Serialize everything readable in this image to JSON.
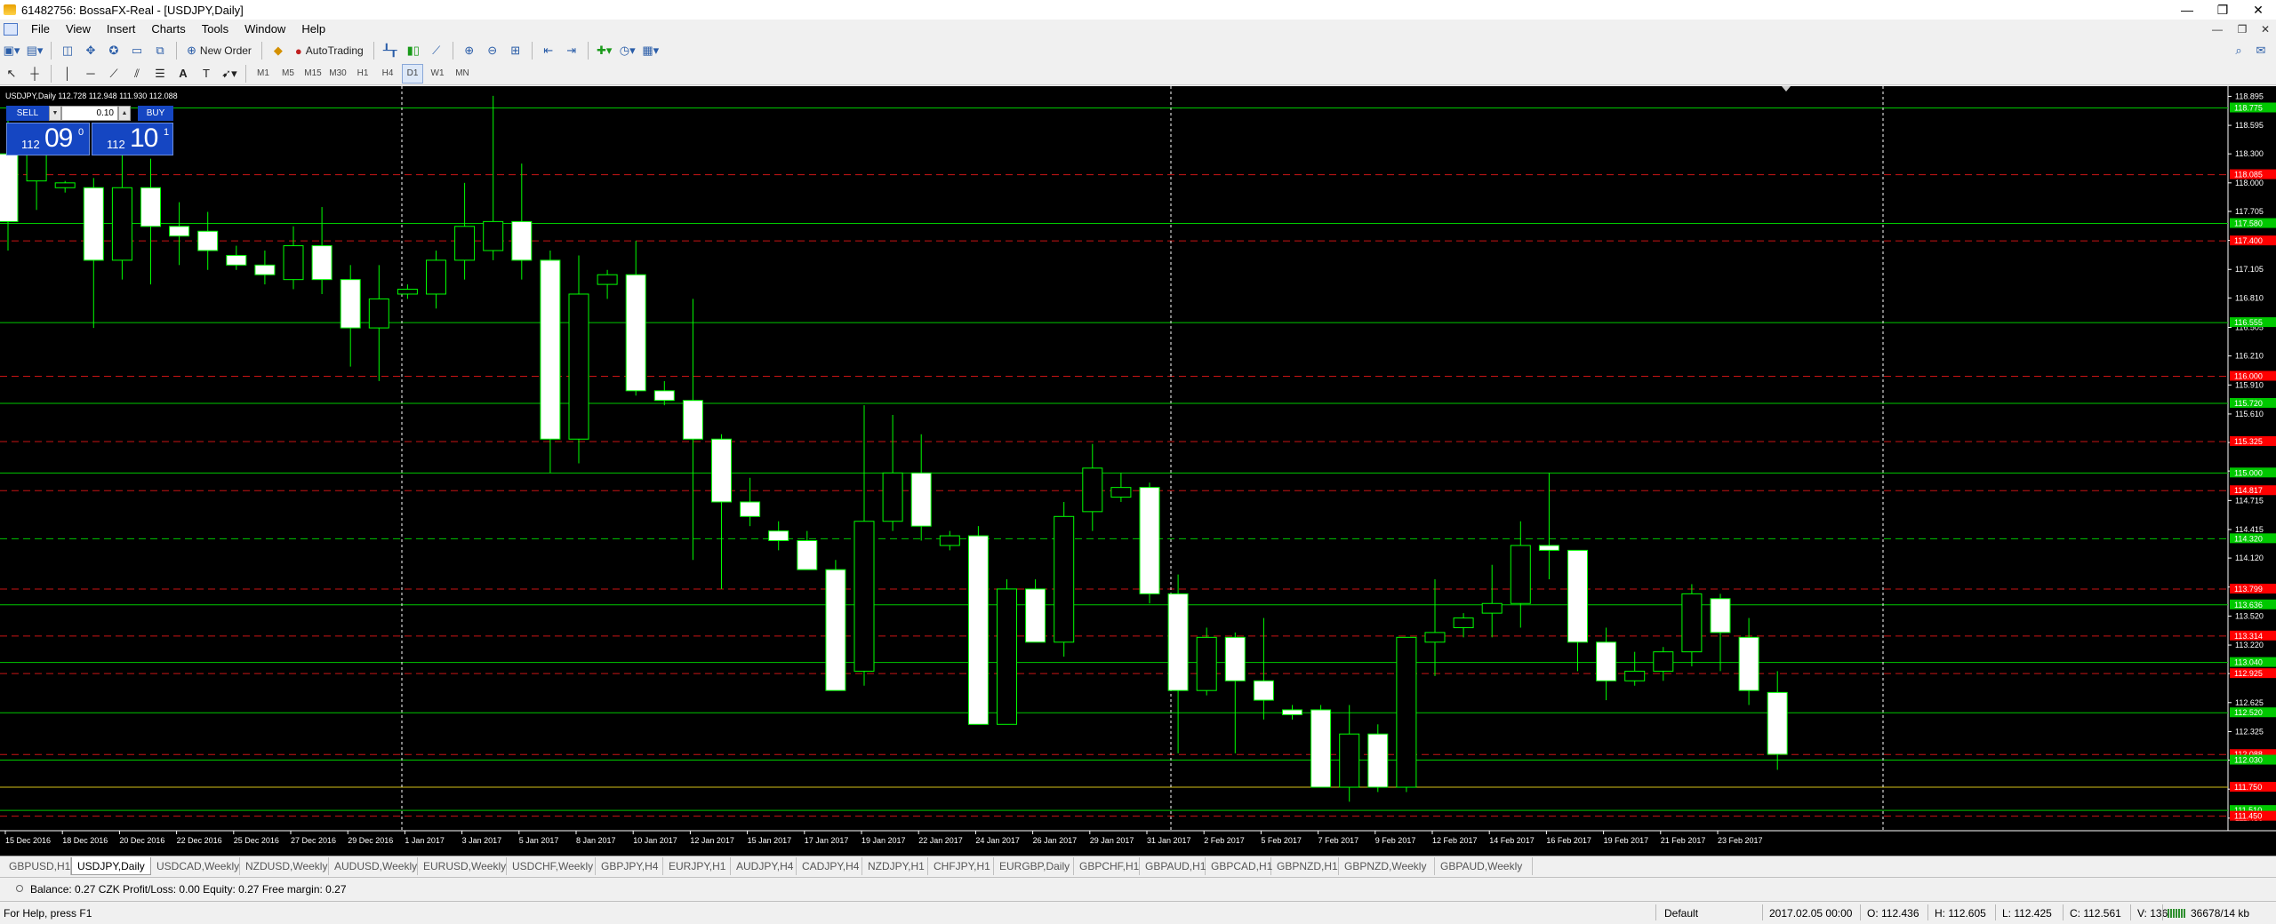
{
  "window": {
    "title": "61482756: BossaFX-Real - [USDJPY,Daily]",
    "controls": [
      "—",
      "❐",
      "✕"
    ],
    "mdi_controls": [
      "—",
      "❐",
      "✕"
    ]
  },
  "menu": [
    "File",
    "View",
    "Insert",
    "Charts",
    "Tools",
    "Window",
    "Help"
  ],
  "toolbar1": {
    "new_order": "New Order",
    "auto_trading": "AutoTrading"
  },
  "timeframes": [
    "M1",
    "M5",
    "M15",
    "M30",
    "H1",
    "H4",
    "D1",
    "W1",
    "MN"
  ],
  "chart": {
    "info": "USDJPY,Daily  112.728 112.948 111.930 112.088",
    "sell_label": "SELL",
    "buy_label": "BUY",
    "lot": "0.10",
    "bid": {
      "small": "112",
      "big": "09",
      "sup": "0"
    },
    "ask": {
      "small": "112",
      "big": "10",
      "sup": "1"
    },
    "colors": {
      "background": "#000000",
      "candle_up": "#000000",
      "candle_down": "#ffffff",
      "candle_border": "#00ff00",
      "hline_green": "#00c800",
      "hline_red": "#c81414",
      "price_tag_green": "#00c800",
      "price_tag_red": "#ff0000",
      "ask_line": "#d4c018"
    },
    "ticks": [
      "118.895",
      "118.595",
      "118.300",
      "118.000",
      "117.705",
      "117.405",
      "117.105",
      "116.810",
      "116.505",
      "116.210",
      "115.910",
      "115.610",
      "115.315",
      "115.020",
      "114.715",
      "114.415",
      "114.120",
      "113.820",
      "113.520",
      "113.220",
      "112.925",
      "112.625",
      "112.325",
      "112.030",
      "111.730",
      "111.430"
    ],
    "price_tags": [
      {
        "price": "118.775",
        "color": "green"
      },
      {
        "price": "118.085",
        "color": "red"
      },
      {
        "price": "117.580",
        "color": "green"
      },
      {
        "price": "117.400",
        "color": "red"
      },
      {
        "price": "116.555",
        "color": "green"
      },
      {
        "price": "116.000",
        "color": "red"
      },
      {
        "price": "115.720",
        "color": "green"
      },
      {
        "price": "115.325",
        "color": "red"
      },
      {
        "price": "115.000",
        "color": "green"
      },
      {
        "price": "114.817",
        "color": "red"
      },
      {
        "price": "114.320",
        "color": "green"
      },
      {
        "price": "113.799",
        "color": "red"
      },
      {
        "price": "113.636",
        "color": "green"
      },
      {
        "price": "113.314",
        "color": "red"
      },
      {
        "price": "113.040",
        "color": "green"
      },
      {
        "price": "112.925",
        "color": "red"
      },
      {
        "price": "112.520",
        "color": "green"
      },
      {
        "price": "112.088",
        "color": "red"
      },
      {
        "price": "112.030",
        "color": "green"
      },
      {
        "price": "111.750",
        "color": "red"
      },
      {
        "price": "111.510",
        "color": "green"
      },
      {
        "price": "111.450",
        "color": "red"
      }
    ],
    "dates": [
      "15 Dec 2016",
      "18 Dec 2016",
      "20 Dec 2016",
      "22 Dec 2016",
      "25 Dec 2016",
      "27 Dec 2016",
      "29 Dec 2016",
      "1 Jan 2017",
      "3 Jan 2017",
      "5 Jan 2017",
      "8 Jan 2017",
      "10 Jan 2017",
      "12 Jan 2017",
      "15 Jan 2017",
      "17 Jan 2017",
      "19 Jan 2017",
      "22 Jan 2017",
      "24 Jan 2017",
      "26 Jan 2017",
      "29 Jan 2017",
      "31 Jan 2017",
      "2 Feb 2017",
      "5 Feb 2017",
      "7 Feb 2017",
      "9 Feb 2017",
      "12 Feb 2017",
      "14 Feb 2017",
      "16 Feb 2017",
      "19 Feb 2017",
      "21 Feb 2017",
      "23 Feb 2017"
    ]
  },
  "chart_data": {
    "type": "candlestick",
    "symbol": "USDJPY",
    "timeframe": "Daily",
    "ylim": [
      111.3,
      119.0
    ],
    "candles": [
      {
        "o": 118.3,
        "h": 118.7,
        "l": 117.3,
        "c": 117.6
      },
      {
        "o": 118.02,
        "h": 118.52,
        "l": 117.72,
        "c": 118.3
      },
      {
        "o": 117.95,
        "h": 118.02,
        "l": 117.9,
        "c": 118.0
      },
      {
        "o": 117.95,
        "h": 118.05,
        "l": 116.5,
        "c": 117.2
      },
      {
        "o": 117.2,
        "h": 118.3,
        "l": 117.0,
        "c": 117.95
      },
      {
        "o": 117.95,
        "h": 118.25,
        "l": 116.95,
        "c": 117.55
      },
      {
        "o": 117.55,
        "h": 117.8,
        "l": 117.15,
        "c": 117.45
      },
      {
        "o": 117.5,
        "h": 117.7,
        "l": 117.1,
        "c": 117.3
      },
      {
        "o": 117.25,
        "h": 117.35,
        "l": 117.1,
        "c": 117.15
      },
      {
        "o": 117.15,
        "h": 117.3,
        "l": 116.95,
        "c": 117.05
      },
      {
        "o": 117.0,
        "h": 117.55,
        "l": 116.9,
        "c": 117.35
      },
      {
        "o": 117.35,
        "h": 117.75,
        "l": 116.85,
        "c": 117.0
      },
      {
        "o": 117.0,
        "h": 117.15,
        "l": 116.1,
        "c": 116.5
      },
      {
        "o": 116.5,
        "h": 117.15,
        "l": 115.95,
        "c": 116.8
      },
      {
        "o": 116.85,
        "h": 116.95,
        "l": 116.8,
        "c": 116.9
      },
      {
        "o": 116.85,
        "h": 117.3,
        "l": 116.7,
        "c": 117.2
      },
      {
        "o": 117.2,
        "h": 118.0,
        "l": 117.0,
        "c": 117.55
      },
      {
        "o": 117.3,
        "h": 118.9,
        "l": 117.2,
        "c": 117.6
      },
      {
        "o": 117.6,
        "h": 118.2,
        "l": 117.0,
        "c": 117.2
      },
      {
        "o": 117.2,
        "h": 117.3,
        "l": 115.0,
        "c": 115.35
      },
      {
        "o": 115.35,
        "h": 117.25,
        "l": 115.1,
        "c": 116.85
      },
      {
        "o": 116.95,
        "h": 117.1,
        "l": 116.8,
        "c": 117.05
      },
      {
        "o": 117.05,
        "h": 117.4,
        "l": 115.8,
        "c": 115.85
      },
      {
        "o": 115.85,
        "h": 115.95,
        "l": 115.7,
        "c": 115.75
      },
      {
        "o": 115.75,
        "h": 116.8,
        "l": 114.1,
        "c": 115.35
      },
      {
        "o": 115.35,
        "h": 115.4,
        "l": 113.8,
        "c": 114.7
      },
      {
        "o": 114.7,
        "h": 114.95,
        "l": 114.45,
        "c": 114.55
      },
      {
        "o": 114.4,
        "h": 114.5,
        "l": 114.2,
        "c": 114.3
      },
      {
        "o": 114.3,
        "h": 114.4,
        "l": 114.05,
        "c": 114.0
      },
      {
        "o": 114.0,
        "h": 114.1,
        "l": 112.8,
        "c": 112.75
      },
      {
        "o": 112.95,
        "h": 115.7,
        "l": 112.8,
        "c": 114.5
      },
      {
        "o": 114.5,
        "h": 115.6,
        "l": 114.4,
        "c": 115.0
      },
      {
        "o": 115.0,
        "h": 115.4,
        "l": 114.3,
        "c": 114.45
      },
      {
        "o": 114.25,
        "h": 114.4,
        "l": 114.2,
        "c": 114.35
      },
      {
        "o": 114.35,
        "h": 114.45,
        "l": 112.4,
        "c": 112.4
      },
      {
        "o": 112.4,
        "h": 113.9,
        "l": 112.4,
        "c": 113.8
      },
      {
        "o": 113.8,
        "h": 113.9,
        "l": 113.3,
        "c": 113.25
      },
      {
        "o": 113.25,
        "h": 114.7,
        "l": 113.1,
        "c": 114.55
      },
      {
        "o": 114.6,
        "h": 115.3,
        "l": 114.4,
        "c": 115.05
      },
      {
        "o": 114.75,
        "h": 115.0,
        "l": 114.7,
        "c": 114.85
      },
      {
        "o": 114.85,
        "h": 114.9,
        "l": 113.65,
        "c": 113.75
      },
      {
        "o": 113.75,
        "h": 113.95,
        "l": 112.1,
        "c": 112.75
      },
      {
        "o": 112.75,
        "h": 113.4,
        "l": 112.7,
        "c": 113.3
      },
      {
        "o": 113.3,
        "h": 113.35,
        "l": 112.1,
        "c": 112.85
      },
      {
        "o": 112.85,
        "h": 113.5,
        "l": 112.45,
        "c": 112.65
      },
      {
        "o": 112.55,
        "h": 112.6,
        "l": 112.45,
        "c": 112.5
      },
      {
        "o": 112.55,
        "h": 112.6,
        "l": 111.8,
        "c": 111.75
      },
      {
        "o": 111.75,
        "h": 112.6,
        "l": 111.6,
        "c": 112.3
      },
      {
        "o": 112.3,
        "h": 112.4,
        "l": 111.7,
        "c": 111.75
      },
      {
        "o": 111.75,
        "h": 113.3,
        "l": 111.7,
        "c": 113.3
      },
      {
        "o": 113.25,
        "h": 113.9,
        "l": 112.9,
        "c": 113.35
      },
      {
        "o": 113.4,
        "h": 113.55,
        "l": 113.3,
        "c": 113.5
      },
      {
        "o": 113.55,
        "h": 114.05,
        "l": 113.3,
        "c": 113.65
      },
      {
        "o": 113.65,
        "h": 114.5,
        "l": 113.4,
        "c": 114.25
      },
      {
        "o": 114.25,
        "h": 115.0,
        "l": 113.9,
        "c": 114.2
      },
      {
        "o": 114.2,
        "h": 114.2,
        "l": 112.95,
        "c": 113.25
      },
      {
        "o": 113.25,
        "h": 113.4,
        "l": 112.65,
        "c": 112.85
      },
      {
        "o": 112.85,
        "h": 113.15,
        "l": 112.8,
        "c": 112.95
      },
      {
        "o": 112.95,
        "h": 113.2,
        "l": 112.85,
        "c": 113.15
      },
      {
        "o": 113.15,
        "h": 113.85,
        "l": 113.0,
        "c": 113.75
      },
      {
        "o": 113.7,
        "h": 113.75,
        "l": 112.95,
        "c": 113.35
      },
      {
        "o": 113.3,
        "h": 113.5,
        "l": 112.6,
        "c": 112.75
      },
      {
        "o": 112.73,
        "h": 112.95,
        "l": 111.93,
        "c": 112.09
      }
    ],
    "horizontal_lines": [
      {
        "price": 118.775,
        "color": "green",
        "style": "solid"
      },
      {
        "price": 118.085,
        "color": "red",
        "style": "dashed"
      },
      {
        "price": 117.58,
        "color": "green",
        "style": "solid"
      },
      {
        "price": 117.4,
        "color": "red",
        "style": "dashed"
      },
      {
        "price": 116.555,
        "color": "green",
        "style": "solid"
      },
      {
        "price": 116.0,
        "color": "red",
        "style": "dashed"
      },
      {
        "price": 115.72,
        "color": "green",
        "style": "solid"
      },
      {
        "price": 115.325,
        "color": "red",
        "style": "dashed"
      },
      {
        "price": 115.0,
        "color": "green",
        "style": "solid"
      },
      {
        "price": 114.817,
        "color": "red",
        "style": "dashed"
      },
      {
        "price": 114.32,
        "color": "green",
        "style": "dashed"
      },
      {
        "price": 113.799,
        "color": "red",
        "style": "dashed"
      },
      {
        "price": 113.636,
        "color": "green",
        "style": "solid"
      },
      {
        "price": 113.314,
        "color": "red",
        "style": "dashed"
      },
      {
        "price": 113.04,
        "color": "green",
        "style": "solid"
      },
      {
        "price": 112.925,
        "color": "red",
        "style": "dashed"
      },
      {
        "price": 112.52,
        "color": "green",
        "style": "solid"
      },
      {
        "price": 112.088,
        "color": "red",
        "style": "dashed"
      },
      {
        "price": 112.03,
        "color": "green",
        "style": "solid"
      },
      {
        "price": 111.75,
        "color": "gold",
        "style": "solid"
      },
      {
        "price": 111.51,
        "color": "green",
        "style": "solid"
      },
      {
        "price": 111.45,
        "color": "red",
        "style": "dashed"
      }
    ],
    "vertical_separators": [
      "1 Jan 2017",
      "1 Feb 2017",
      "1 Mar 2017"
    ],
    "grid": false
  },
  "tabs": {
    "items": [
      "GBPUSD,H1",
      "USDJPY,Daily",
      "USDCAD,Weekly",
      "NZDUSD,Weekly",
      "AUDUSD,Weekly",
      "EURUSD,Weekly",
      "USDCHF,Weekly",
      "GBPJPY,H4",
      "EURJPY,H1",
      "AUDJPY,H4",
      "CADJPY,H4",
      "NZDJPY,H1",
      "CHFJPY,H1",
      "EURGBP,Daily",
      "GBPCHF,H1",
      "GBPAUD,H1",
      "GBPCAD,H1",
      "GBPNZD,H1",
      "GBPNZD,Weekly",
      "GBPAUD,Weekly"
    ],
    "active": 1
  },
  "terminal": {
    "balance": "Balance: 0.27 CZK  Profit/Loss: 0.00  Equity: 0.27  Free margin: 0.27"
  },
  "status": {
    "help": "For Help, press F1",
    "profile": "Default",
    "time": "2017.02.05 00:00",
    "open": "O: 112.436",
    "high": "H: 112.605",
    "low": "L: 112.425",
    "close": "C: 112.561",
    "volume": "V: 1363",
    "traffic": "36678/14 kb"
  }
}
